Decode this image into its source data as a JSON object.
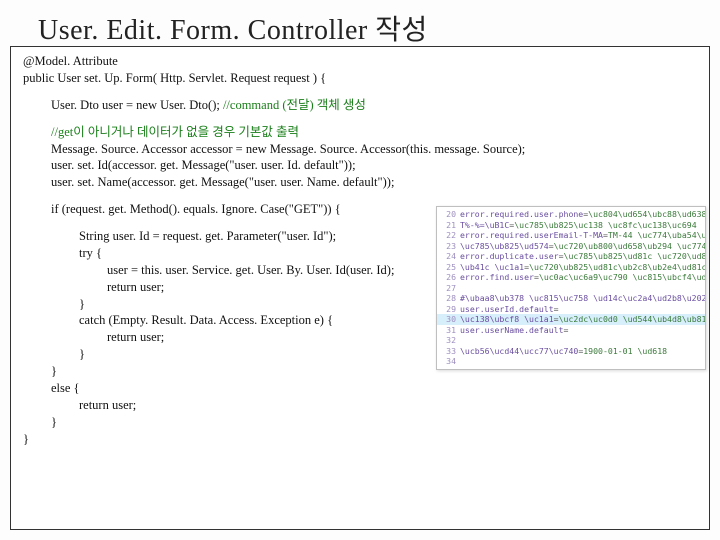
{
  "title": {
    "prefix": "User. Edit. Form. Controller",
    "suffix": " 작성"
  },
  "code": {
    "l1": "@Model. Attribute",
    "l2": "public User set. Up. Form( Http. Servlet. Request request ) {",
    "l3a": "User. Dto user = new User. Dto(); ",
    "l3b": "//command (전달) 객체 생성",
    "l4": "//get이 아니거나 데이터가 없을 경우 기본값 출력",
    "l5": "Message. Source. Accessor accessor = new Message. Source. Accessor(this. message. Source);",
    "l6": "user. set. Id(accessor. get. Message(\"user. user. Id. default\"));",
    "l7": "user. set. Name(accessor. get. Message(\"user. user. Name. default\"));",
    "l8": "if (request. get. Method(). equals. Ignore. Case(\"GET\")) {",
    "l9": "String user. Id = request. get. Parameter(\"user. Id\");",
    "l10": "try {",
    "l11": "user = this. user. Service. get. User. By. User. Id(user. Id);",
    "l12": "return user;",
    "l13": "}",
    "l14": "catch (Empty. Result. Data. Access. Exception e) {",
    "l15": "return  user;",
    "l16": "}",
    "l17": "}",
    "l18": "else {",
    "l19": "return user;",
    "l20": "}",
    "l21": "}"
  },
  "overlay": {
    "rows": [
      {
        "ln": "20",
        "k": "error.required.user.phone",
        "v": "\\uc804\\ud654\\ubc88\\ud638"
      },
      {
        "ln": "21",
        "k": "T%-%=\\uB1C",
        "v": "\\uc785\\ub825\\uc138 \\uc8fc\\uc138\\uc694"
      },
      {
        "ln": "22",
        "k": "error.required.userEmail-T-MA",
        "v": "TM-44 \\uc774\\uba54\\uc77c"
      },
      {
        "ln": "23",
        "k": "\\uc785\\ub825\\ud574",
        "v": "\\uc720\\ub800\\ud658\\ub294 \\uc774"
      },
      {
        "ln": "24",
        "k": "error.duplicate.user",
        "v": "\\uc785\\ub825\\ud81c \\uc720\\ud81"
      },
      {
        "ln": "25",
        "k": "\\ub41c \\uc1a1",
        "v": "\\uc720\\ub825\\ud81c\\ub2c8\\ub2e4\\ud81c"
      },
      {
        "ln": "26",
        "k": "error.find.user",
        "v": "\\uc0ac\\uc6a9\\uc790 \\uc815\\ubcf4\\ud81"
      },
      {
        "ln": "27",
        "k": "",
        "v": ""
      },
      {
        "ln": "28",
        "k": "#\\ubaa8\\ub378 \\uc815\\uc758 \\ud14c\\uc2a4\\ud2b8\\u2026",
        "v": ""
      },
      {
        "ln": "29",
        "k": "user.userId.default",
        "v": ""
      },
      {
        "ln": "30",
        "k": "\\uc138\\ubcf8 \\uc1a1",
        "v": "\\uc2dc\\uc0d0 \\ud544\\ub4d8\\ub81c\\ub2c8"
      },
      {
        "ln": "31",
        "k": "user.userName.default",
        "v": ""
      },
      {
        "ln": "32",
        "k": "",
        "v": ""
      },
      {
        "ln": "33",
        "k": "\\ucb56\\ucd44\\ucc77\\uc740",
        "v": "1900-01-01 \\ud618"
      },
      {
        "ln": "34",
        "k": "",
        "v": ""
      }
    ],
    "hl_index": 10
  }
}
